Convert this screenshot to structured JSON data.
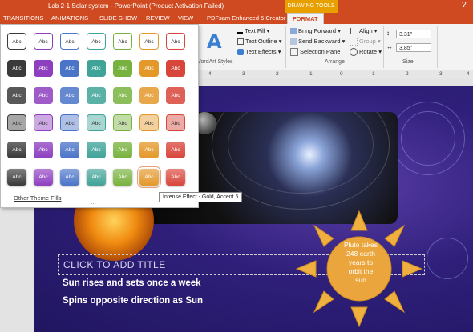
{
  "window": {
    "title": "Lab 2-1 Solar system -  PowerPoint (Product Activation Failed)",
    "context_tab_group": "DRAWING TOOLS",
    "help": "?"
  },
  "tabs": [
    "TRANSITIONS",
    "ANIMATIONS",
    "SLIDE SHOW",
    "REVIEW",
    "VIEW",
    "PDFsam Enhanced 5 Creator",
    "FORMAT"
  ],
  "ribbon": {
    "wordart": {
      "text_fill": "Text Fill",
      "text_outline": "Text Outline",
      "text_effects": "Text Effects",
      "group_label": "WordArt Styles"
    },
    "arrange": {
      "bring_forward": "Bring Forward",
      "send_backward": "Send Backward",
      "selection_pane": "Selection Pane",
      "align": "Align",
      "group": "Group",
      "rotate": "Rotate",
      "group_label": "Arrange"
    },
    "size": {
      "height": "3.31\"",
      "width": "3.85\"",
      "group_label": "Size"
    }
  },
  "ruler": {
    "numbers": [
      "4",
      "3",
      "2",
      "1",
      "0",
      "1",
      "2",
      "3",
      "4"
    ]
  },
  "gallery": {
    "rows": [
      [
        "Abc",
        "Abc",
        "Abc",
        "Abc",
        "Abc",
        "Abc",
        "Abc"
      ],
      [
        "Abc",
        "Abc",
        "Abc",
        "Abc",
        "Abc",
        "Abc",
        "Abc"
      ],
      [
        "Abc",
        "Abc",
        "Abc",
        "Abc",
        "Abc",
        "Abc",
        "Abc"
      ],
      [
        "Abc",
        "Abc",
        "Abc",
        "Abc",
        "Abc",
        "Abc",
        "Abc"
      ],
      [
        "Abc",
        "Abc",
        "Abc",
        "Abc",
        "Abc",
        "Abc",
        "Abc"
      ],
      [
        "Abc",
        "Abc",
        "Abc",
        "Abc",
        "Abc",
        "Abc",
        "Abc"
      ]
    ],
    "accent_colors": [
      "#3a3a3a",
      "#8e3fc0",
      "#4a74c8",
      "#3fa398",
      "#78b23e",
      "#e4982a",
      "#d8453a"
    ],
    "other_fills": "Other Theme Fills",
    "tooltip": "Intense Effect - Gold, Accent 5"
  },
  "slide": {
    "title_placeholder": "CLICK TO ADD TITLE",
    "bullets": [
      "Sun  rises and sets once a week",
      "Spins opposite direction as Sun"
    ],
    "sun_text": [
      "Pluto takes",
      "248 earth",
      "years to",
      "orbit the",
      "sun"
    ]
  }
}
